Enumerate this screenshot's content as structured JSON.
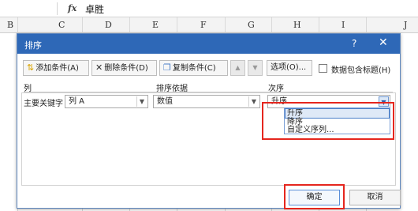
{
  "formula_bar": {
    "fx": "fx",
    "value": "卓胜"
  },
  "columns": [
    "B",
    "C",
    "D",
    "E",
    "F",
    "G",
    "H",
    "I",
    "J"
  ],
  "dialog": {
    "title": "排序",
    "help": "?",
    "close": "✕",
    "toolbar": {
      "add": "添加条件(A)",
      "delete": "删除条件(D)",
      "copy": "复制条件(C)",
      "move_up": "▲",
      "move_down": "▼",
      "options": "选项(O)...",
      "has_header": "数据包含标题(H)",
      "has_header_checked": false
    },
    "headers": {
      "column": "列",
      "sort_on": "排序依据",
      "order": "次序"
    },
    "rule": {
      "label": "主要关键字",
      "column_value": "列 A",
      "sort_on_value": "数值",
      "order_value": "升序"
    },
    "order_options": [
      "升序",
      "降序",
      "自定义序列..."
    ],
    "selected_option_index": 0,
    "ok": "确定",
    "cancel": "取消"
  },
  "colors": {
    "titlebar": "#2e68b7",
    "highlight": "#e5261e"
  }
}
